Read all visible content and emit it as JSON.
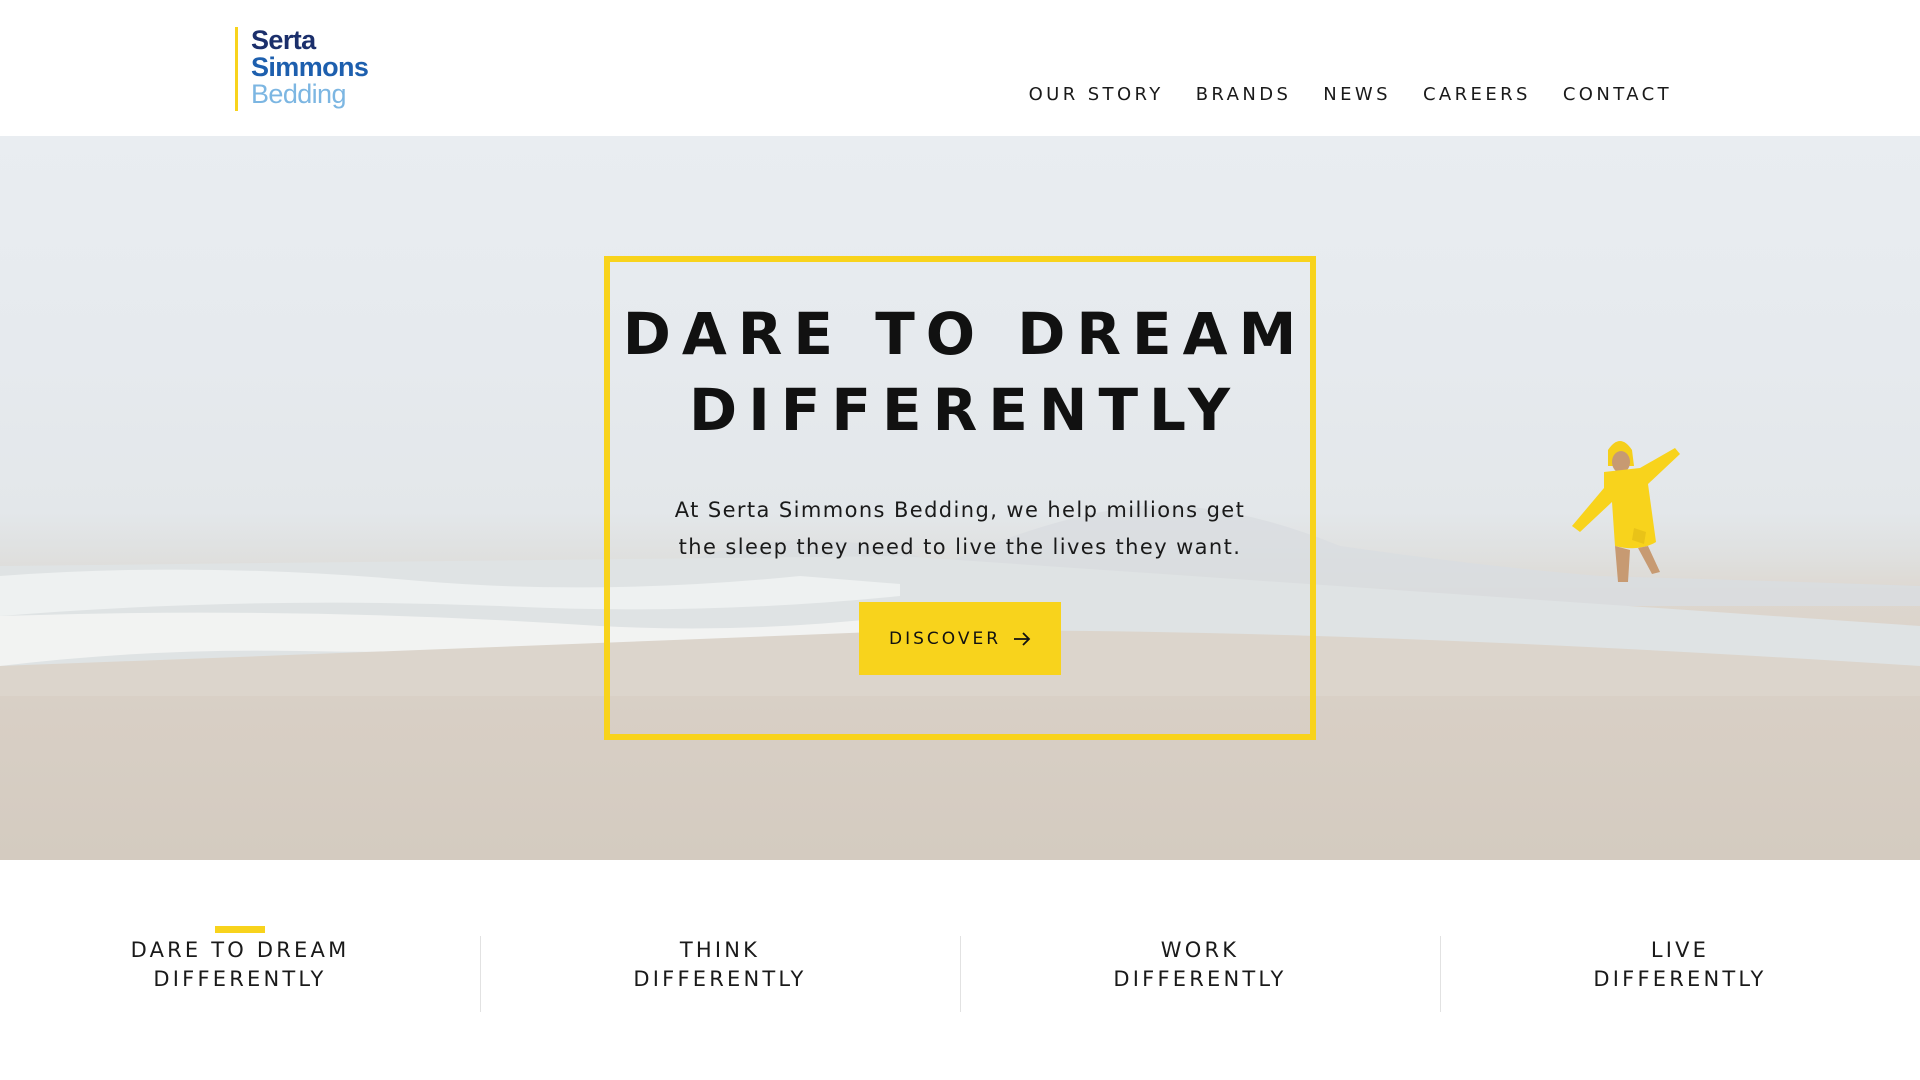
{
  "logo": {
    "line1": "Serta",
    "line2": "Simmons",
    "line3": "Bedding"
  },
  "nav": {
    "items": [
      {
        "label": "OUR STORY"
      },
      {
        "label": "BRANDS"
      },
      {
        "label": "NEWS"
      },
      {
        "label": "CAREERS"
      },
      {
        "label": "CONTACT"
      }
    ]
  },
  "hero": {
    "title_line1": "DARE TO DREAM",
    "title_line2": "DIFFERENTLY",
    "text_line1": "At Serta Simmons Bedding, we help millions get",
    "text_line2": "the sleep they need to live the lives they want.",
    "button_label": "DISCOVER"
  },
  "tabs": [
    {
      "line1": "DARE TO DREAM",
      "line2": "DIFFERENTLY",
      "active": true
    },
    {
      "line1": "THINK",
      "line2": "DIFFERENTLY",
      "active": false
    },
    {
      "line1": "WORK",
      "line2": "DIFFERENTLY",
      "active": false
    },
    {
      "line1": "LIVE",
      "line2": "DIFFERENTLY",
      "active": false
    }
  ],
  "colors": {
    "accent": "#f8d31c",
    "logo_dark": "#1b2f6b",
    "logo_mid": "#1d5fae",
    "logo_light": "#7cb6e2"
  }
}
